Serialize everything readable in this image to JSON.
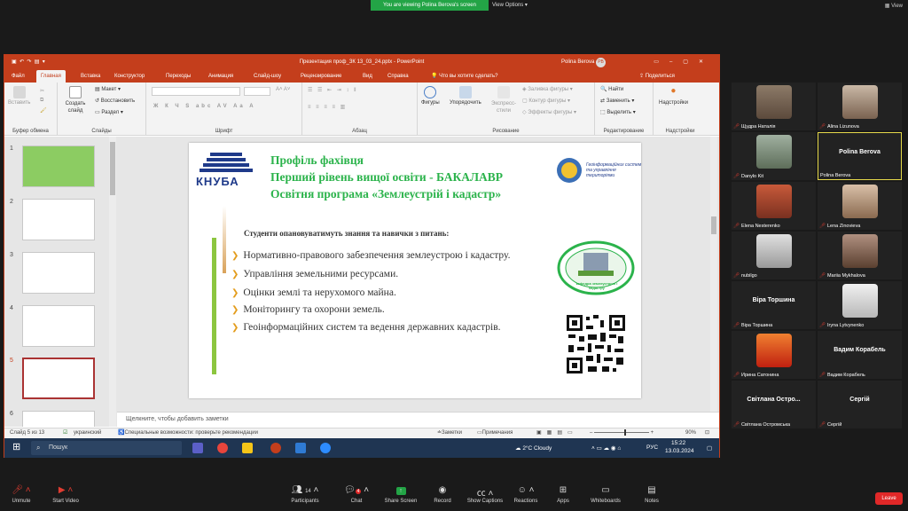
{
  "zoom": {
    "viewing_banner": "You are viewing Polina Berova's screen",
    "view_options": "View Options",
    "view_btn": "View",
    "toolbar": [
      {
        "label": "Unmute",
        "icon": "mic-muted-icon"
      },
      {
        "label": "Start Video",
        "icon": "video-off-icon"
      },
      {
        "label": "Participants",
        "icon": "participants-icon",
        "badge": "14"
      },
      {
        "label": "Chat",
        "icon": "chat-icon",
        "badge": "4"
      },
      {
        "label": "Share Screen",
        "icon": "share-screen-icon"
      },
      {
        "label": "Record",
        "icon": "record-icon"
      },
      {
        "label": "Show Captions",
        "icon": "captions-icon"
      },
      {
        "label": "Reactions",
        "icon": "reactions-icon"
      },
      {
        "label": "Apps",
        "icon": "apps-icon"
      },
      {
        "label": "Whiteboards",
        "icon": "whiteboard-icon"
      },
      {
        "label": "Notes",
        "icon": "notes-icon"
      }
    ],
    "leave": "Leave",
    "participants": [
      {
        "name": "Щудра Наталія",
        "display": "",
        "type": "photo"
      },
      {
        "name": "Alina Lizunova",
        "display": "",
        "type": "photo"
      },
      {
        "name": "Danylo Kit",
        "display": "",
        "type": "photo"
      },
      {
        "name": "Polina Berova",
        "display": "Polina Berova",
        "type": "name"
      },
      {
        "name": "Elena Nesterenko",
        "display": "",
        "type": "photo"
      },
      {
        "name": "Lena Zinovieva",
        "display": "",
        "type": "photo"
      },
      {
        "name": "nubilgo",
        "display": "",
        "type": "photo"
      },
      {
        "name": "Mariia Mykhalova",
        "display": "",
        "type": "photo"
      },
      {
        "name": "Віра Торшина",
        "display": "Віра Торшина",
        "type": "name"
      },
      {
        "name": "Iryna Lytvynenko",
        "display": "",
        "type": "photo"
      },
      {
        "name": "Ирина Сатонина",
        "display": "",
        "type": "photo"
      },
      {
        "name": "Вадим Корабель",
        "display": "Вадим Корабель",
        "type": "name"
      },
      {
        "name": "Світлана Остромська",
        "display": "Світлана Остро...",
        "type": "name"
      },
      {
        "name": "Сергій",
        "display": "Сергій",
        "type": "name"
      }
    ]
  },
  "ppt": {
    "title": "Презентация проф_ЗК 13_03_24.pptx  -  PowerPoint",
    "user": "Polina Berova",
    "user_initials": "PB",
    "tabs": [
      "Файл",
      "Главная",
      "Вставка",
      "Конструктор",
      "Переходы",
      "Анимация",
      "Слайд-шоу",
      "Рецензирование",
      "Вид",
      "Справка"
    ],
    "tell_me": "Что вы хотите сделать?",
    "share": "Поделиться",
    "ribbon": {
      "paste": "Вставить",
      "clipboard": "Буфер обмена",
      "create_slide": "Создать слайд",
      "layout": "Макет",
      "restore": "Восстановить",
      "section": "Раздел",
      "slides": "Слайды",
      "font": "Шрифт",
      "paragraph": "Абзац",
      "shapes": "Фигуры",
      "arrange": "Упорядочить",
      "quick_styles": "Экспресс-стили",
      "fill": "Заливка фигуры",
      "outline": "Контур фигуры",
      "effects": "Эффекты фигуры",
      "drawing": "Рисование",
      "find": "Найти",
      "replace": "Заменить",
      "select": "Выделить",
      "editing": "Редактирование",
      "addins": "Надстройки",
      "addins_group": "Надстройки"
    },
    "thumb_numbers": [
      "1",
      "2",
      "3",
      "4",
      "5",
      "6"
    ],
    "notes_placeholder": "Щелкните, чтобы добавить заметки",
    "status": {
      "slide": "Слайд 5 из 13",
      "lang": "украинский",
      "accessibility": "Специальные возможности: проверьте рекомендации",
      "notes": "Заметки",
      "comments": "Примечания",
      "zoom": "90%"
    }
  },
  "slide": {
    "logo_text": "КНУБА",
    "title_lines": [
      "Профіль фахівця",
      "Перший рівень вищої освіти - БАКАЛАВР",
      "Освітня програма «Землеустрій і кадастр»"
    ],
    "geo_logo_text": "Геоінформаційних систем та управління територіями",
    "round_logo_text": "кафедра землеустрою і кадастру",
    "subtitle": "Студенти опановуватимуть знання та навички з питань:",
    "bullets": [
      "Нормативно-правового забезпечення землеустрою і кадастру.",
      "Управління земельними ресурсами.",
      "Оцінки землі та нерухомого майна.",
      "Моніторингу та охорони земель.",
      "Геоінформаційних систем та ведення державних кадастрів."
    ]
  },
  "taskbar": {
    "search": "Пошук",
    "weather": "2°C  Cloudy",
    "lang": "РУС",
    "time": "15:22",
    "date": "13.03.2024"
  },
  "colors": {
    "ppt_accent": "#c43e1c",
    "slide_green": "#2bb34b",
    "zoom_green": "#23a446",
    "leave_red": "#e02828"
  }
}
